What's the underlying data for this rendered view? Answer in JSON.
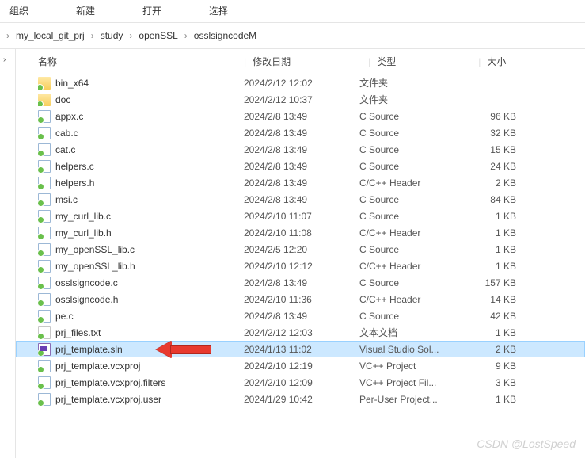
{
  "toolbar": {
    "organize": "组织",
    "new": "新建",
    "open": "打开",
    "select": "选择"
  },
  "breadcrumb": {
    "items": [
      "my_local_git_prj",
      "study",
      "openSSL",
      "osslsigncodeM"
    ]
  },
  "columns": {
    "name": "名称",
    "date": "修改日期",
    "type": "类型",
    "size": "大小"
  },
  "files": [
    {
      "icon": "folder",
      "name": "bin_x64",
      "date": "2024/2/12 12:02",
      "type": "文件夹",
      "size": ""
    },
    {
      "icon": "folder",
      "name": "doc",
      "date": "2024/2/12 10:37",
      "type": "文件夹",
      "size": ""
    },
    {
      "icon": "c",
      "name": "appx.c",
      "date": "2024/2/8 13:49",
      "type": "C Source",
      "size": "96 KB"
    },
    {
      "icon": "c",
      "name": "cab.c",
      "date": "2024/2/8 13:49",
      "type": "C Source",
      "size": "32 KB"
    },
    {
      "icon": "c",
      "name": "cat.c",
      "date": "2024/2/8 13:49",
      "type": "C Source",
      "size": "15 KB"
    },
    {
      "icon": "c",
      "name": "helpers.c",
      "date": "2024/2/8 13:49",
      "type": "C Source",
      "size": "24 KB"
    },
    {
      "icon": "h",
      "name": "helpers.h",
      "date": "2024/2/8 13:49",
      "type": "C/C++ Header",
      "size": "2 KB"
    },
    {
      "icon": "c",
      "name": "msi.c",
      "date": "2024/2/8 13:49",
      "type": "C Source",
      "size": "84 KB"
    },
    {
      "icon": "c",
      "name": "my_curl_lib.c",
      "date": "2024/2/10 11:07",
      "type": "C Source",
      "size": "1 KB"
    },
    {
      "icon": "h",
      "name": "my_curl_lib.h",
      "date": "2024/2/10 11:08",
      "type": "C/C++ Header",
      "size": "1 KB"
    },
    {
      "icon": "c",
      "name": "my_openSSL_lib.c",
      "date": "2024/2/5 12:20",
      "type": "C Source",
      "size": "1 KB"
    },
    {
      "icon": "h",
      "name": "my_openSSL_lib.h",
      "date": "2024/2/10 12:12",
      "type": "C/C++ Header",
      "size": "1 KB"
    },
    {
      "icon": "c",
      "name": "osslsigncode.c",
      "date": "2024/2/8 13:49",
      "type": "C Source",
      "size": "157 KB"
    },
    {
      "icon": "h",
      "name": "osslsigncode.h",
      "date": "2024/2/10 11:36",
      "type": "C/C++ Header",
      "size": "14 KB"
    },
    {
      "icon": "c",
      "name": "pe.c",
      "date": "2024/2/8 13:49",
      "type": "C Source",
      "size": "42 KB"
    },
    {
      "icon": "txt",
      "name": "prj_files.txt",
      "date": "2024/2/12 12:03",
      "type": "文本文档",
      "size": "1 KB"
    },
    {
      "icon": "sln",
      "name": "prj_template.sln",
      "date": "2024/1/13 11:02",
      "type": "Visual Studio Sol...",
      "size": "2 KB",
      "selected": true,
      "arrow": true
    },
    {
      "icon": "vcx",
      "name": "prj_template.vcxproj",
      "date": "2024/2/10 12:19",
      "type": "VC++ Project",
      "size": "9 KB"
    },
    {
      "icon": "vcx",
      "name": "prj_template.vcxproj.filters",
      "date": "2024/2/10 12:09",
      "type": "VC++ Project Fil...",
      "size": "3 KB"
    },
    {
      "icon": "vcx",
      "name": "prj_template.vcxproj.user",
      "date": "2024/1/29 10:42",
      "type": "Per-User Project...",
      "size": "1 KB"
    }
  ],
  "watermark": "CSDN @LostSpeed"
}
